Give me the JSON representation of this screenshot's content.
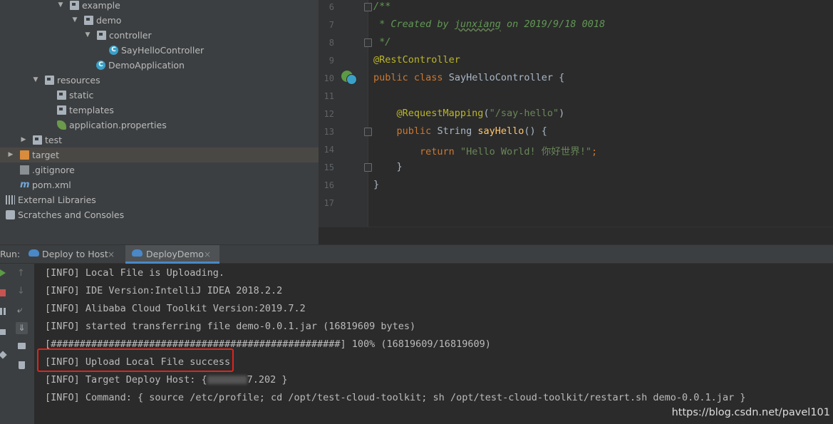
{
  "project_tree": [
    {
      "label": "example",
      "indent": 80,
      "arrow": "▼",
      "icon": "folder-icon"
    },
    {
      "label": "demo",
      "indent": 100,
      "arrow": "▼",
      "icon": "folder-icon"
    },
    {
      "label": "controller",
      "indent": 118,
      "arrow": "▼",
      "icon": "folder-icon"
    },
    {
      "label": "SayHelloController",
      "indent": 153,
      "arrow": "",
      "icon": "class-icon"
    },
    {
      "label": "DemoApplication",
      "indent": 135,
      "arrow": "",
      "icon": "spring-app-icon"
    },
    {
      "label": "resources",
      "indent": 45,
      "arrow": "▼",
      "icon": "resources-folder-icon"
    },
    {
      "label": "static",
      "indent": 80,
      "arrow": "",
      "icon": "folder-icon"
    },
    {
      "label": "templates",
      "indent": 80,
      "arrow": "",
      "icon": "folder-icon"
    },
    {
      "label": "application.properties",
      "indent": 80,
      "arrow": "",
      "icon": "spring-properties-icon"
    },
    {
      "label": "test",
      "indent": 28,
      "arrow": "▶",
      "icon": "folder-icon"
    },
    {
      "label": "target",
      "indent": 10,
      "arrow": "▶",
      "icon": "orange-folder-icon",
      "selected": true
    },
    {
      "label": ".gitignore",
      "indent": 28,
      "arrow": "",
      "icon": "file-icon"
    },
    {
      "label": "pom.xml",
      "indent": 28,
      "arrow": "",
      "icon": "maven-icon"
    },
    {
      "label": "External Libraries",
      "indent": 8,
      "arrow": "",
      "icon": "libraries-icon"
    },
    {
      "label": "Scratches and Consoles",
      "indent": 8,
      "arrow": "",
      "icon": "scratches-icon"
    }
  ],
  "editor": {
    "line_numbers": [
      "6",
      "7",
      "8",
      "9",
      "10",
      "11",
      "12",
      "13",
      "14",
      "15",
      "16",
      "17"
    ],
    "comment_open": "/**",
    "comment_created": " * Created by ",
    "comment_author": "junxiang",
    "comment_date": " on 2019/9/18 0018",
    "comment_close": " */",
    "annotation_rest": "@RestController",
    "kw_public": "public",
    "kw_class": "class",
    "class_name": "SayHelloController {",
    "annotation_mapping": "@RequestMapping",
    "mapping_open": "(",
    "mapping_path": "\"/say-hello\"",
    "mapping_close": ")",
    "kw_public2": "public",
    "return_type": "String",
    "method_name": "sayHello",
    "method_rest": "() {",
    "kw_return": "return",
    "return_string": "\"Hello World! 你好世界!\"",
    "semicolon": ";",
    "close_brace_method": "}",
    "close_brace_class": "}"
  },
  "run_panel": {
    "run_label": "Run:",
    "tabs": [
      {
        "label": "Deploy to Host",
        "close": "×"
      },
      {
        "label": "DeployDemo",
        "close": "×",
        "active": true
      }
    ]
  },
  "console_lines": [
    "[INFO] Local File is Uploading.",
    "[INFO] IDE Version:IntelliJ IDEA 2018.2.2",
    "[INFO] Alibaba Cloud Toolkit Version:2019.7.2",
    "[INFO] started transferring file demo-0.0.1.jar (16819609 bytes)",
    "[##################################################] 100% (16819609/16819609)",
    "[INFO] Upload Local File success",
    "[INFO] Command: { source /etc/profile; cd /opt/test-cloud-toolkit; sh /opt/test-cloud-toolkit/restart.sh demo-0.0.1.jar }"
  ],
  "target_host": {
    "prefix": "[INFO] Target Deploy Host: {",
    "suffix": "7.202 }"
  },
  "watermark": "https://blog.csdn.net/pavel101",
  "colors": {
    "highlight_box": "#e0241c",
    "accent": "#4a88c7"
  }
}
